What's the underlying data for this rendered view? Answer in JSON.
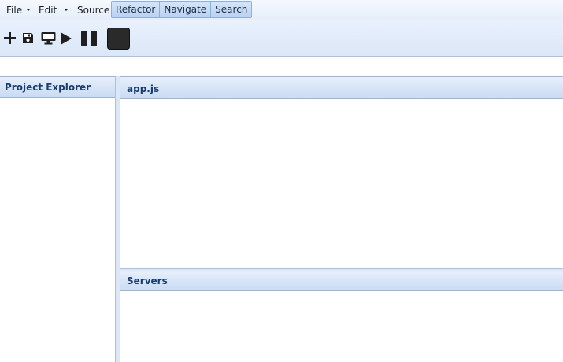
{
  "menubar": {
    "file_label": "File",
    "edit_label": "Edit",
    "source_label": "Source",
    "buttons": [
      "Refactor",
      "Navigate",
      "Search"
    ]
  },
  "toolbar": {
    "icons": [
      "plus-icon",
      "save-icon",
      "monitor-icon",
      "play-icon",
      "pause-icon",
      "stop-icon"
    ]
  },
  "panels": {
    "project_explorer_title": "Project Explorer",
    "editor_title": "app.js",
    "servers_title": "Servers"
  },
  "colors": {
    "accent": "#1a3d6e",
    "header_bg": "#c9dbf3",
    "border": "#9ab6dc"
  }
}
